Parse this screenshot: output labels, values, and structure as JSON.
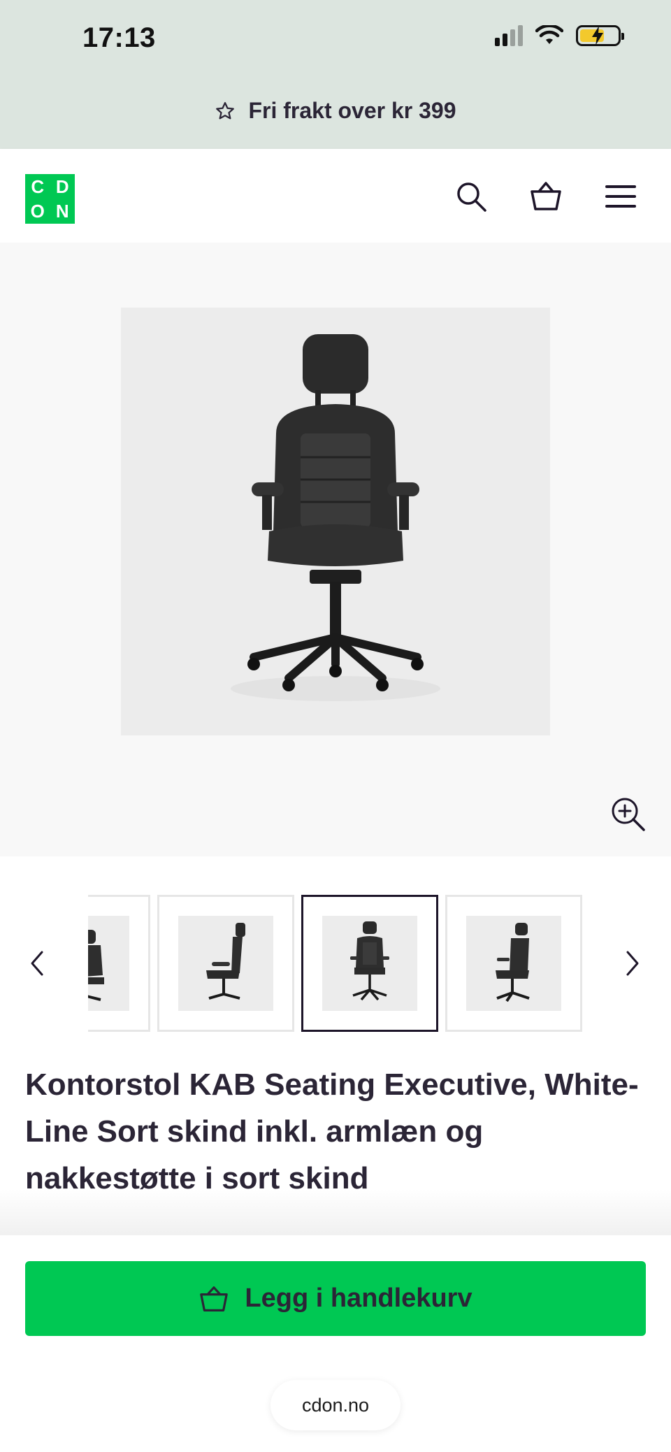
{
  "status_bar": {
    "time": "17:13"
  },
  "promo": {
    "icon": "star-icon",
    "text": "Fri frakt over kr 399"
  },
  "header": {
    "logo_letters": [
      "C",
      "D",
      "O",
      "N"
    ],
    "logo_color": "#00c853",
    "icons": [
      "search-icon",
      "basket-icon",
      "menu-icon"
    ]
  },
  "gallery": {
    "main_image": "office-chair-front-view",
    "thumbnails": [
      "chair-side-partial",
      "chair-side-view",
      "chair-front-view",
      "chair-three-quarter-view"
    ],
    "active_thumbnail": 2
  },
  "product": {
    "title": "Kontorstol KAB Seating Executive, White-Line Sort skind inkl. armlæn og nakkestøtte i sort skind"
  },
  "cta": {
    "label": "Legg i handlekurv",
    "color": "#00c853"
  },
  "browser": {
    "url": "cdon.no"
  }
}
